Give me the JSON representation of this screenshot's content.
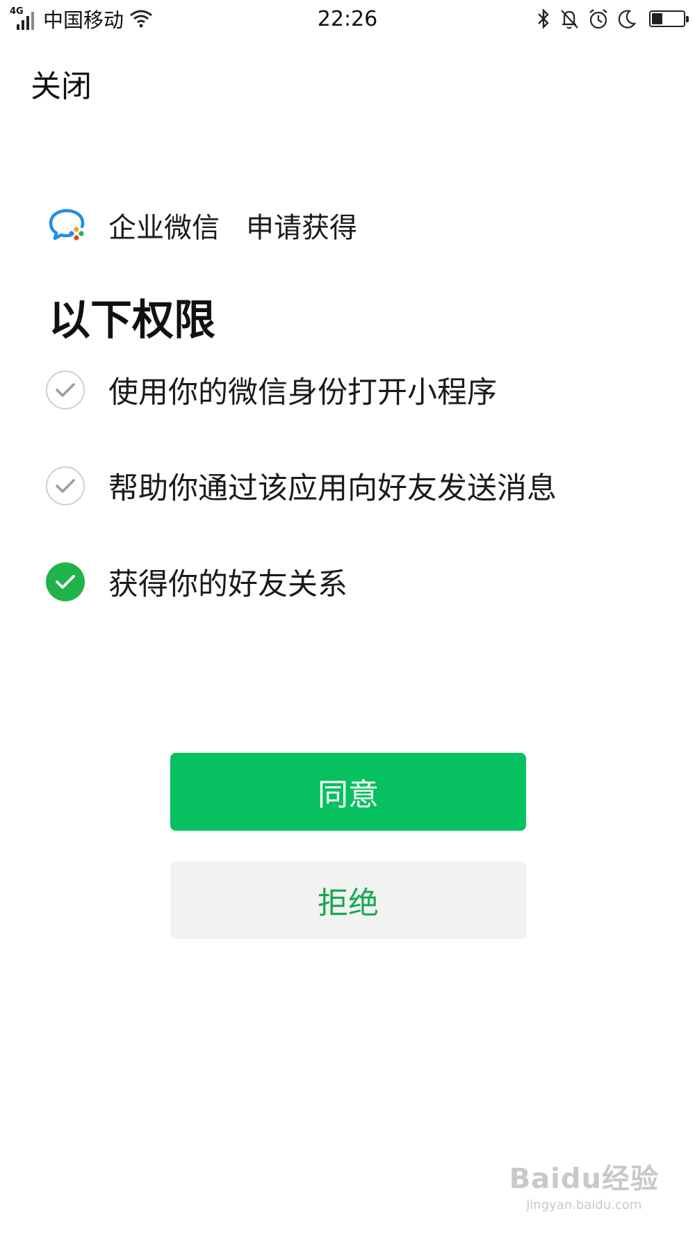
{
  "status_bar": {
    "network_type": "4G",
    "carrier": "中国移动",
    "time": "22:26",
    "battery_level": 0.35,
    "icons": [
      "signal-icon",
      "wifi-icon",
      "bluetooth-icon",
      "mute-bell-icon",
      "alarm-icon",
      "do-not-disturb-moon-icon",
      "battery-icon"
    ]
  },
  "header": {
    "close_label": "关闭"
  },
  "request": {
    "app_name": "企业微信",
    "request_text": "申请获得",
    "heading": "以下权限",
    "logo_icon": "wecom-logo-icon"
  },
  "permissions": [
    {
      "label": "使用你的微信身份打开小程序",
      "checked": false
    },
    {
      "label": "帮助你通过该应用向好友发送消息",
      "checked": false
    },
    {
      "label": "获得你的好友关系",
      "checked": true
    }
  ],
  "buttons": {
    "agree_label": "同意",
    "reject_label": "拒绝"
  },
  "colors": {
    "primary_green": "#07c160",
    "check_green": "#20b34a",
    "reject_bg": "#f2f2f2",
    "reject_text": "#15a84f"
  },
  "watermark": {
    "brand": "Baidu经验",
    "url": "jingyan.baidu.com"
  }
}
